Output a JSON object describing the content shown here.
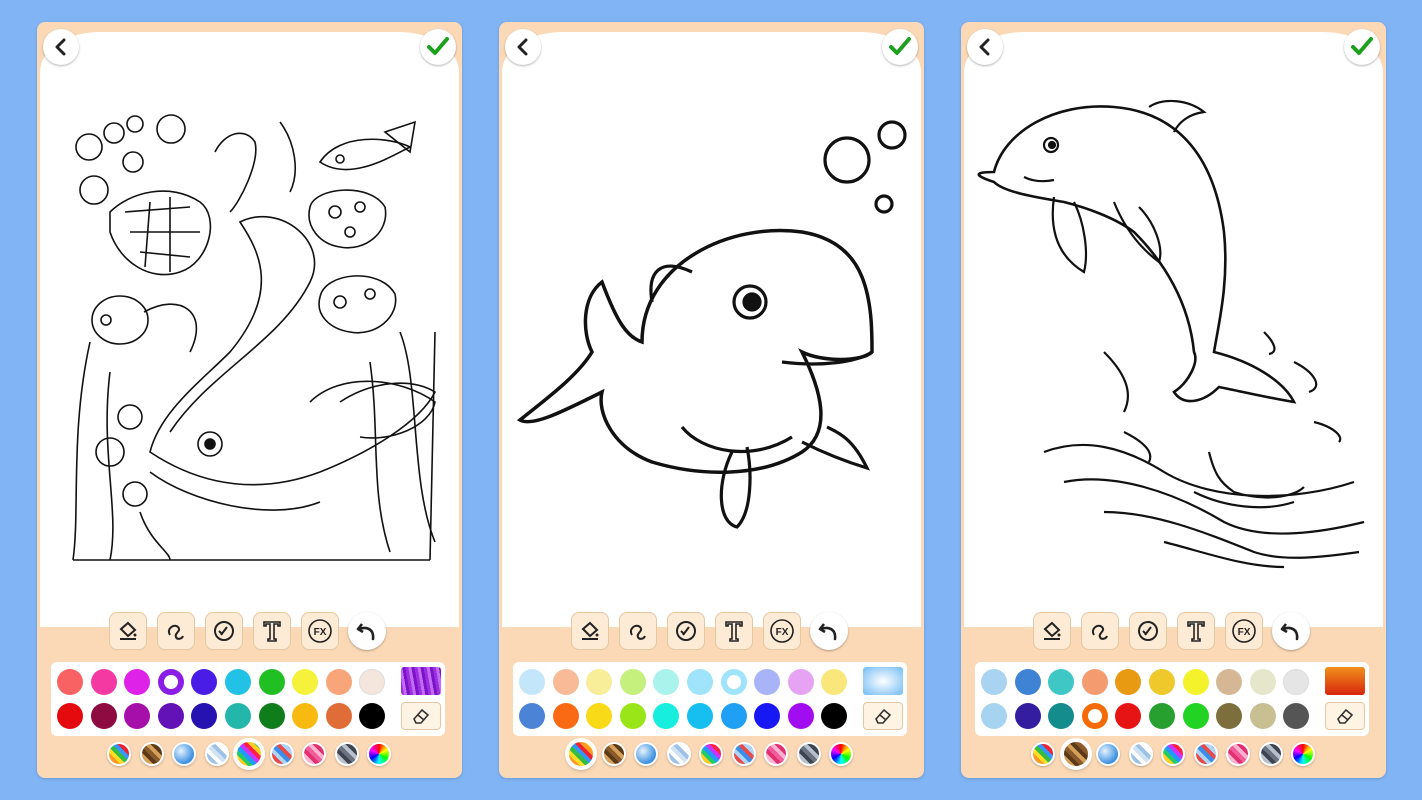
{
  "panels": [
    {
      "artwork": "underwater-scene",
      "selected_mode": 4,
      "special_swatch": "purple-texture",
      "colors": [
        [
          "#F96263",
          "#F43AA2",
          "#DE22E8",
          "#8A1DE6",
          "#4A1DE7",
          "#22C2E6",
          "#20C025",
          "#F6F23B",
          "#F9A57A",
          "#F4E6DC"
        ],
        [
          "#E50A0E",
          "#8D0B41",
          "#A60FA9",
          "#6312B7",
          "#2612B0",
          "#23B7AC",
          "#0E7D1A",
          "#F8BA11",
          "#E06D38",
          "#000000"
        ]
      ],
      "selected_color": [
        0,
        3
      ]
    },
    {
      "artwork": "cartoon-dolphin",
      "selected_mode": 0,
      "special_swatch": "light-blue-gradient",
      "colors": [
        [
          "#C3E6FA",
          "#F9BA98",
          "#F8ED98",
          "#C5F07E",
          "#A9F3EC",
          "#9FE4FA",
          "#9FE4FA",
          "#A8B4F7",
          "#E6A3F4",
          "#F9E77B"
        ],
        [
          "#4B84D6",
          "#FA6A15",
          "#F8DA18",
          "#99E517",
          "#17EEDE",
          "#17BEF0",
          "#1FA0F4",
          "#1818F4",
          "#A10DF0",
          "#000000"
        ]
      ],
      "selected_color": [
        0,
        6
      ]
    },
    {
      "artwork": "jumping-dolphin",
      "selected_mode": 1,
      "special_swatch": "orange-red-gradient",
      "colors": [
        [
          "#A8D3F1",
          "#3F84D4",
          "#3EC7C5",
          "#F49C70",
          "#E89A13",
          "#EFC92B",
          "#F4F22A",
          "#D6B795",
          "#E6E6CA",
          "#E5E5E5"
        ],
        [
          "#A6D4F0",
          "#341D9F",
          "#148C8D",
          "#F66A08",
          "#E61414",
          "#27A02F",
          "#22D323",
          "#7C6E3D",
          "#C8BF92",
          "#555555"
        ]
      ],
      "selected_color": [
        1,
        3
      ]
    }
  ],
  "tools": [
    "fill-bucket-tool",
    "lasso-tool",
    "brush-tool",
    "text-tool",
    "fx-tool",
    "undo-button"
  ],
  "tool_labels": {
    "text": "T",
    "fx": "FX"
  },
  "modes": [
    "rainbow-stripes",
    "brown-stripes",
    "blue-shine",
    "pastel-blue",
    "multicolor",
    "blue-red-shine",
    "pink-shine",
    "gray-shine",
    "color-wheel"
  ],
  "colors": {
    "background": "#80B4F5",
    "panel": "#FBD9B6",
    "check": "#1DA01D"
  }
}
